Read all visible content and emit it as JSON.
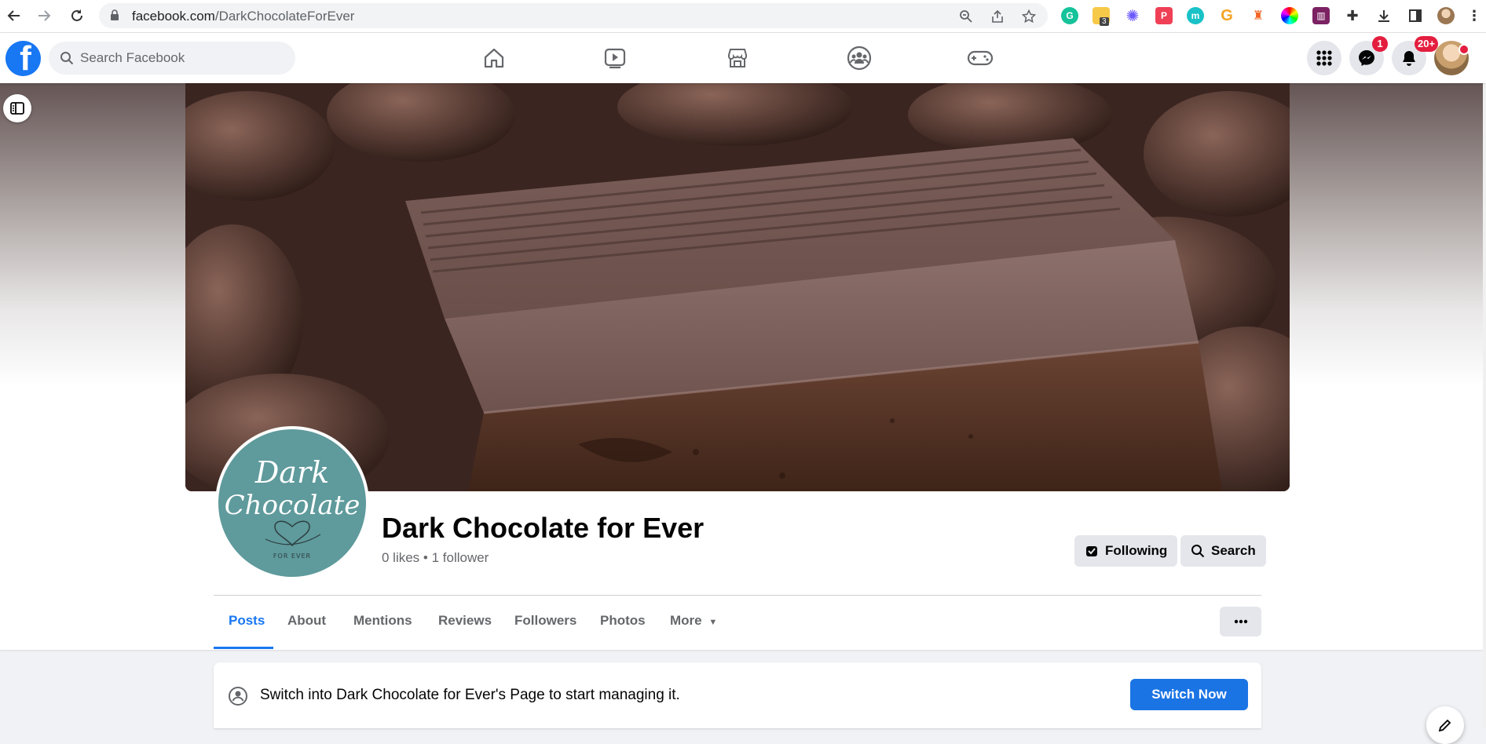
{
  "browser": {
    "url_host": "facebook.com",
    "url_path": "/DarkChocolateForEver",
    "extension_badge": "3"
  },
  "header": {
    "search_placeholder": "Search Facebook",
    "messenger_badge": "1",
    "notifications_badge": "20+",
    "brand_color": "#1877f2"
  },
  "page": {
    "name": "Dark Chocolate for Ever",
    "stats": "0 likes • 1 follower",
    "following_label": "Following",
    "search_label": "Search",
    "profile_line1": "Dark",
    "profile_line2": "Chocolate",
    "profile_tagline": "FOR EVER"
  },
  "tabs": [
    {
      "label": "Posts",
      "active": true
    },
    {
      "label": "About"
    },
    {
      "label": "Mentions"
    },
    {
      "label": "Reviews"
    },
    {
      "label": "Followers"
    },
    {
      "label": "Photos"
    },
    {
      "label": "More"
    }
  ],
  "manage": {
    "text": "Switch into Dark Chocolate for Ever's Page to start managing it.",
    "button": "Switch Now"
  }
}
